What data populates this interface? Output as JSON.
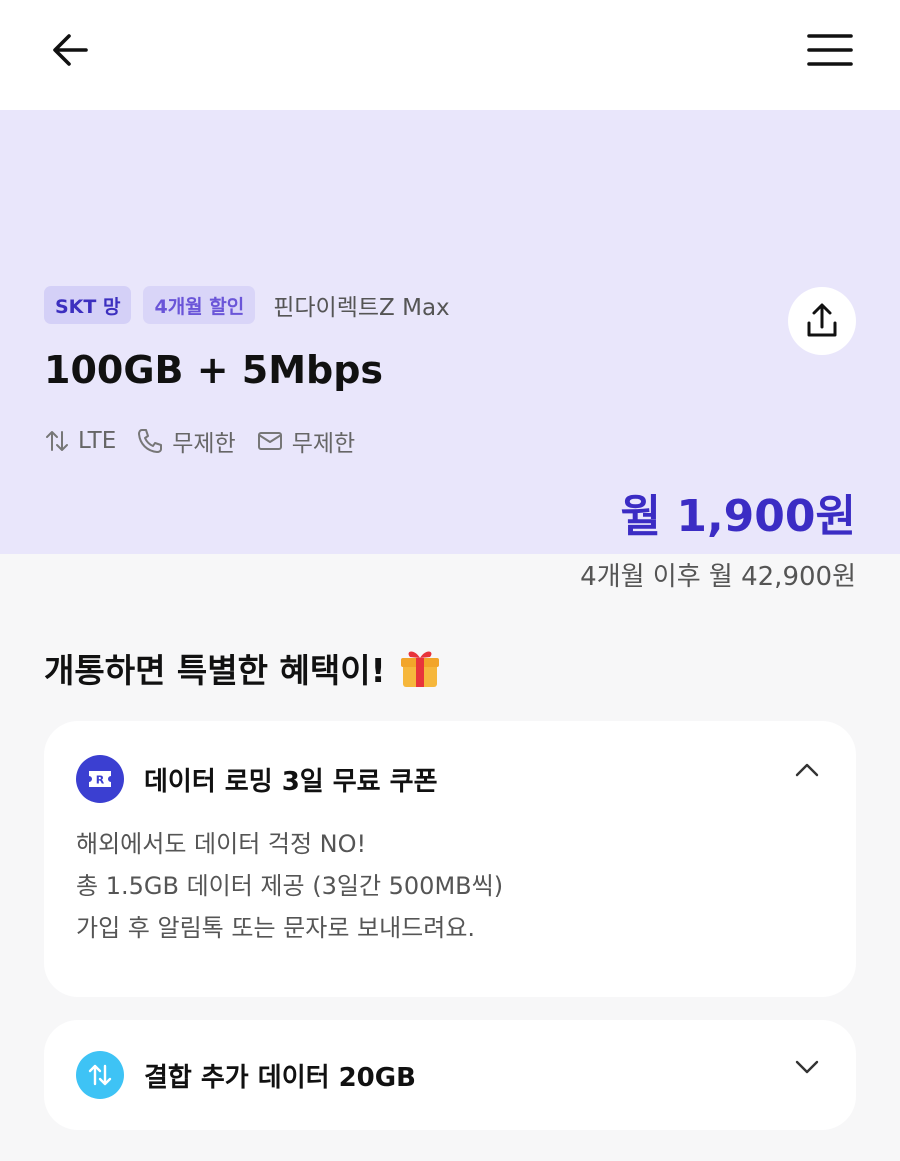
{
  "header": {
    "back_icon": "arrow-left-icon",
    "menu_icon": "hamburger-menu-icon"
  },
  "plan": {
    "network_badge": "SKT 망",
    "discount_badge": "4개월 할인",
    "carrier": "핀다이렉트Z Max",
    "name": "100GB + 5Mbps",
    "specs": {
      "network": "LTE",
      "calls": "무제한",
      "sms": "무제한"
    },
    "price": "월 1,900원",
    "after_price": "4개월 이후 월 42,900원",
    "share_icon": "share-icon"
  },
  "benefits": {
    "title": "개통하면 특별한 혜택이!",
    "gift_icon": "gift-icon",
    "cards": [
      {
        "title": "데이터 로밍 3일 무료 쿠폰",
        "expanded": true,
        "lines": [
          "해외에서도 데이터 걱정 NO!",
          "총 1.5GB 데이터 제공 (3일간 500MB씩)",
          "가입 후 알림톡 또는 문자로 보내드려요."
        ]
      },
      {
        "title": "결합 추가 데이터 20GB",
        "expanded": false
      }
    ]
  },
  "colors": {
    "accent": "#3b2cc4",
    "plan_bg": "#e9e6fb",
    "roaming_icon_bg": "#3b3fd1",
    "data_icon_bg": "#3ec3f5"
  }
}
